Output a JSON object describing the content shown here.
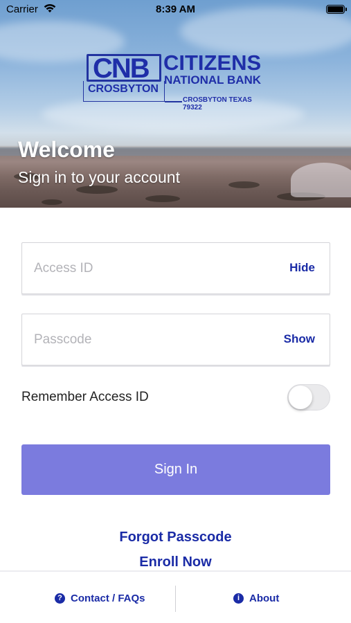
{
  "status_bar": {
    "carrier": "Carrier",
    "time": "8:39 AM"
  },
  "logo": {
    "mark": "CNB",
    "city": "CROSBYTON",
    "name_line1": "CITIZENS",
    "name_line2": "NATIONAL BANK",
    "address": "CROSBYTON TEXAS 79322"
  },
  "hero": {
    "title": "Welcome",
    "subtitle": "Sign in to your account"
  },
  "form": {
    "access_id": {
      "placeholder": "Access ID",
      "value": "",
      "action": "Hide"
    },
    "passcode": {
      "placeholder": "Passcode",
      "value": "",
      "action": "Show"
    },
    "remember": {
      "label": "Remember Access ID",
      "on": false
    },
    "sign_in_label": "Sign In"
  },
  "links": {
    "forgot": "Forgot Passcode",
    "enroll": "Enroll Now"
  },
  "bottom_bar": {
    "contact_label": "Contact / FAQs",
    "contact_icon": "?",
    "about_label": "About",
    "about_icon": "i"
  },
  "colors": {
    "accent": "#1a2ba6",
    "button": "#7b7bde",
    "logo_blue": "#1f2ea8"
  }
}
